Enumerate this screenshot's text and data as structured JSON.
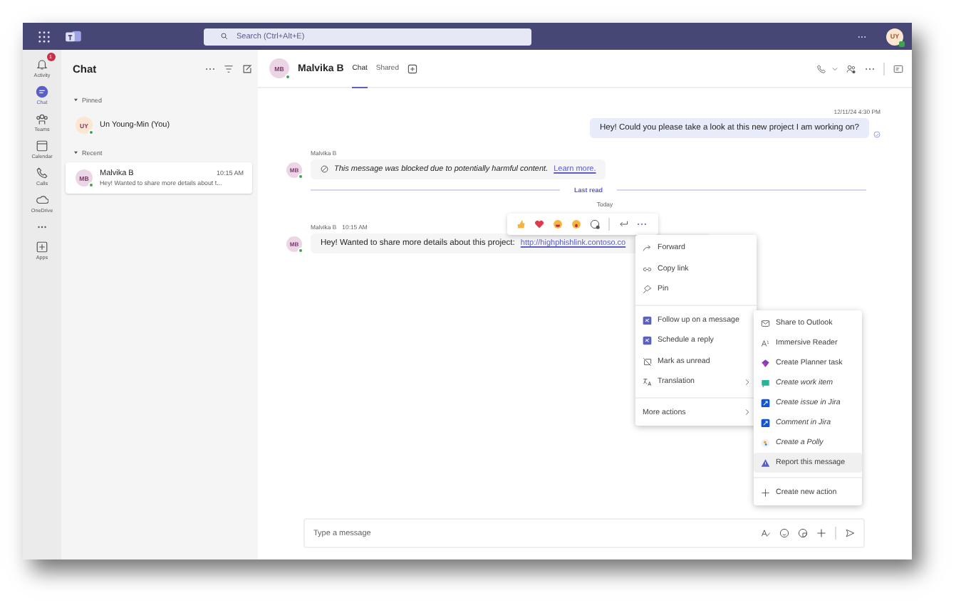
{
  "title_bar": {
    "search": {
      "placeholder": "Search (Ctrl+Alt+E)"
    },
    "avatar": {
      "initials": "UY"
    }
  },
  "rail": {
    "items": [
      {
        "kind": "activity",
        "label": "Activity",
        "badge": "1",
        "selected": false
      },
      {
        "kind": "chat",
        "label": "Chat",
        "selected": true
      },
      {
        "kind": "teams",
        "label": "Teams",
        "selected": false
      },
      {
        "kind": "calendar",
        "label": "Calendar",
        "selected": false
      },
      {
        "kind": "calls",
        "label": "Calls",
        "selected": false
      },
      {
        "kind": "onedrive",
        "label": "OneDrive",
        "selected": false
      },
      {
        "kind": "more",
        "selected": false
      },
      {
        "kind": "apps",
        "label": "Apps",
        "selected": false
      }
    ]
  },
  "chat_list": {
    "title": "Chat",
    "sections": [
      {
        "label": "Pinned",
        "expanded": true,
        "chats": [
          {
            "initials": "UY",
            "name": "Un Young-Min (You)",
            "color": "#fce6d2",
            "selected": false
          }
        ]
      },
      {
        "label": "Recent",
        "expanded": true,
        "chats": [
          {
            "initials": "MB",
            "name": "Malvika B",
            "time": "10:15 AM",
            "preview": "Hey! Wanted to share more details about t...",
            "color": "#ecd5e4",
            "selected": true
          }
        ]
      }
    ]
  },
  "conversation": {
    "header": {
      "initials": "MB",
      "name": "Malvika B",
      "tabs": [
        {
          "label": "Chat",
          "selected": true
        },
        {
          "label": "Shared",
          "selected": false
        }
      ]
    },
    "messages": [
      {
        "kind": "sent",
        "timestamp": "12/11/24 4:30 PM",
        "text": "Hey! Could you please take a look at this new project I am working on?"
      },
      {
        "kind": "blocked",
        "initials": "MB",
        "sender": "Malvika B",
        "text": "This message was blocked due to potentially harmful content.",
        "link": "Learn more."
      },
      {
        "kind": "divider",
        "label": "Last read"
      },
      {
        "kind": "day",
        "label": "Today"
      },
      {
        "kind": "received",
        "initials": "MB",
        "sender": "Malvika B",
        "time": "10:15 AM",
        "text": "Hey! Wanted to share more details about this project:",
        "link": "http://highphishlink.contoso.co"
      }
    ],
    "composer": {
      "placeholder": "Type a message"
    }
  },
  "context_menu": {
    "groups": [
      [
        {
          "kind": "forward",
          "label": "Forward",
          "submenu": false
        },
        {
          "kind": "link",
          "label": "Copy link",
          "submenu": false
        },
        {
          "kind": "pin",
          "label": "Pin",
          "submenu": false
        }
      ],
      [
        {
          "kind": "app",
          "label": "Follow up on a message",
          "submenu": false
        },
        {
          "kind": "app",
          "label": "Schedule a reply",
          "submenu": false
        },
        {
          "kind": "unread",
          "label": "Mark as unread",
          "submenu": false
        },
        {
          "kind": "translate",
          "label": "Translation",
          "submenu": true
        }
      ],
      [
        {
          "kind": "none",
          "label": "More actions",
          "submenu": true
        }
      ]
    ]
  },
  "more_actions_menu": {
    "groups": [
      [
        {
          "kind": "mail",
          "label": "Share to Outlook",
          "italic": false,
          "highlighted": false
        },
        {
          "kind": "reader",
          "label": "Immersive Reader",
          "italic": false,
          "highlighted": false
        },
        {
          "kind": "planner",
          "label": "Create Planner task",
          "italic": false,
          "highlighted": false
        },
        {
          "kind": "workitem",
          "label": "Create work item",
          "italic": true,
          "highlighted": false
        },
        {
          "kind": "jira",
          "label": "Create issue in Jira",
          "italic": true,
          "highlighted": false
        },
        {
          "kind": "jira",
          "label": "Comment in Jira",
          "italic": true,
          "highlighted": false
        },
        {
          "kind": "polly",
          "label": "Create a Polly",
          "italic": true,
          "highlighted": false
        },
        {
          "kind": "report",
          "label": "Report this message",
          "italic": false,
          "highlighted": true
        }
      ],
      [
        {
          "kind": "add",
          "label": "Create new action",
          "italic": false,
          "highlighted": false
        }
      ]
    ]
  }
}
